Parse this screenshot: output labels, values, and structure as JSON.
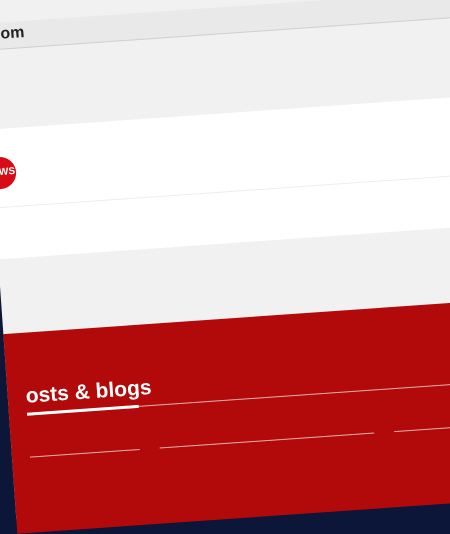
{
  "browser": {
    "address_text": "om"
  },
  "header": {
    "logo_text": "NEWS"
  },
  "footer": {
    "section_title": "osts & blogs"
  },
  "colors": {
    "accent_red": "#b20a0a",
    "logo_red": "#d60d16",
    "background_space": "#0b1638"
  }
}
